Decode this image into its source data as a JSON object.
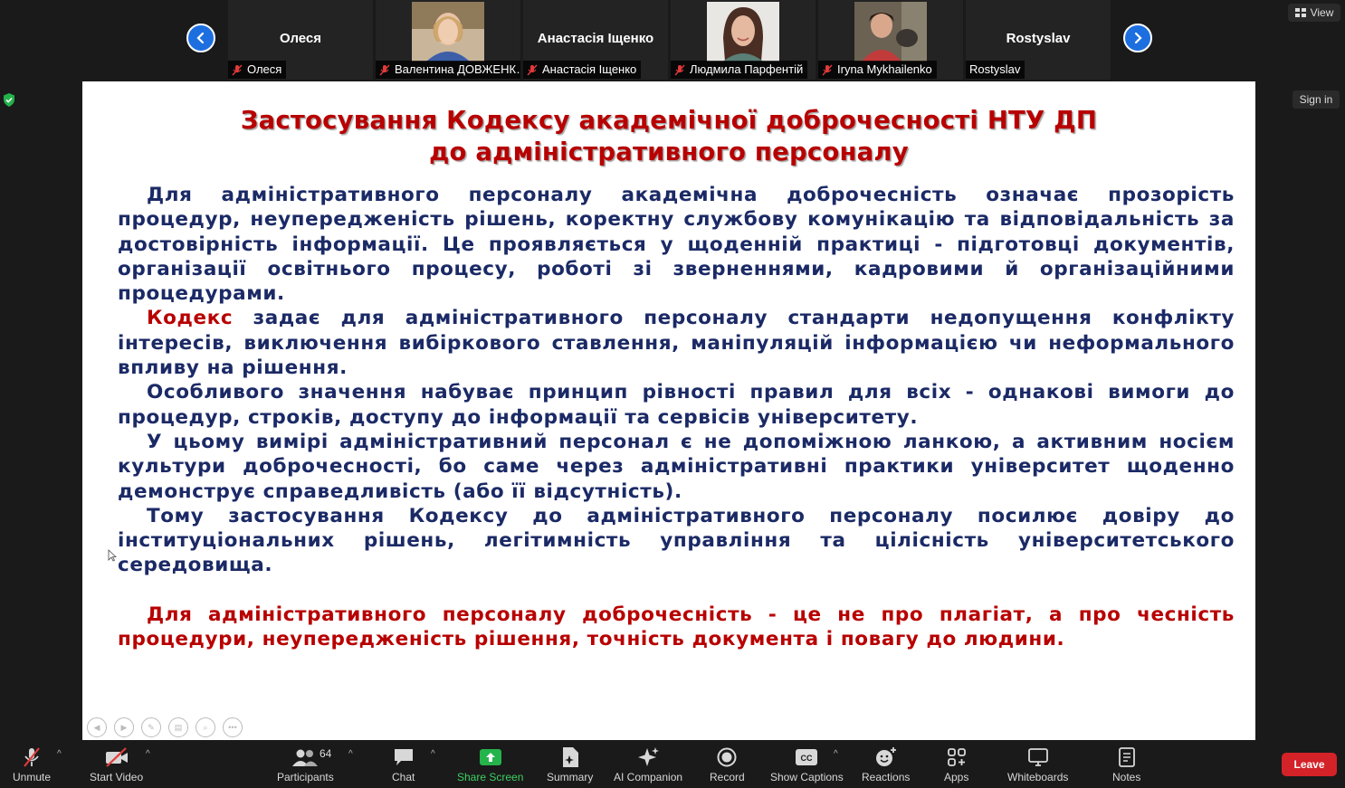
{
  "participants": [
    {
      "display_name": "Олеся",
      "label": "Олеся",
      "has_photo": false
    },
    {
      "display_name": "",
      "label": "Валентина ДОВЖЕНК…",
      "has_photo": true
    },
    {
      "display_name": "Анастасія Іщенко",
      "label": "Анастасія Іщенко",
      "has_photo": false
    },
    {
      "display_name": "",
      "label": "Людмила Парфентій",
      "has_photo": true
    },
    {
      "display_name": "",
      "label": "Iryna Mykhailenko",
      "has_photo": true
    },
    {
      "display_name": "Rostyslav",
      "label": "Rostyslav",
      "has_photo": false
    }
  ],
  "top": {
    "view_label": "View",
    "signin_label": "Sign in"
  },
  "slide": {
    "title_line1": "Застосування Кодексу академічної доброчесності НТУ ДП",
    "title_line2": "до адміністративного персоналу",
    "p1": "Для адміністративного персоналу академічна доброчесність означає прозорість процедур, неупередженість рішень, коректну службову комунікацію та відповідальність за достовірність інформації. Це проявляється у щоденній практиці  - підготовці документів, організації освітнього процесу, роботі зі зверненнями, кадровими й організаційними процедурами.",
    "p2_lead": "Кодекс",
    "p2_rest": " задає для адміністративного персоналу стандарти недопущення конфлікту інтересів, виключення вибіркового ставлення, маніпуляцій інформацією чи неформального впливу на рішення.",
    "p3": "Особливого значення набуває принцип рівності правил для всіх - однакові вимоги до процедур, строків, доступу до інформації та сервісів університету.",
    "p4": "У цьому вимірі адміністративний персонал є не допоміжною ланкою, а активним носієм культури доброчесності, бо саме через адміністративні практики університет щоденно демонструє справедливість (або її відсутність).",
    "p5": "Тому застосування Кодексу до адміністративного персоналу посилює довіру до інституціональних рішень, легітимність управління та цілісність університетського середовища.",
    "p6": "Для адміністративного персоналу доброчесність - це не про плагіат, а про чесність процедури, неупередженість рішення, точність документа і повагу до людини."
  },
  "toolbar": {
    "unmute": "Unmute",
    "start_video": "Start Video",
    "participants": "Participants",
    "participants_count": "64",
    "chat": "Chat",
    "share_screen": "Share Screen",
    "summary": "Summary",
    "ai_companion": "AI Companion",
    "record": "Record",
    "show_captions": "Show Captions",
    "reactions": "Reactions",
    "apps": "Apps",
    "whiteboards": "Whiteboards",
    "notes": "Notes",
    "leave": "Leave"
  },
  "colors": {
    "accent_blue": "#1d6fe0",
    "leave_red": "#d32228",
    "slide_title_red": "#b80000",
    "slide_text_navy": "#1b2a66",
    "share_green": "#25b34b"
  }
}
